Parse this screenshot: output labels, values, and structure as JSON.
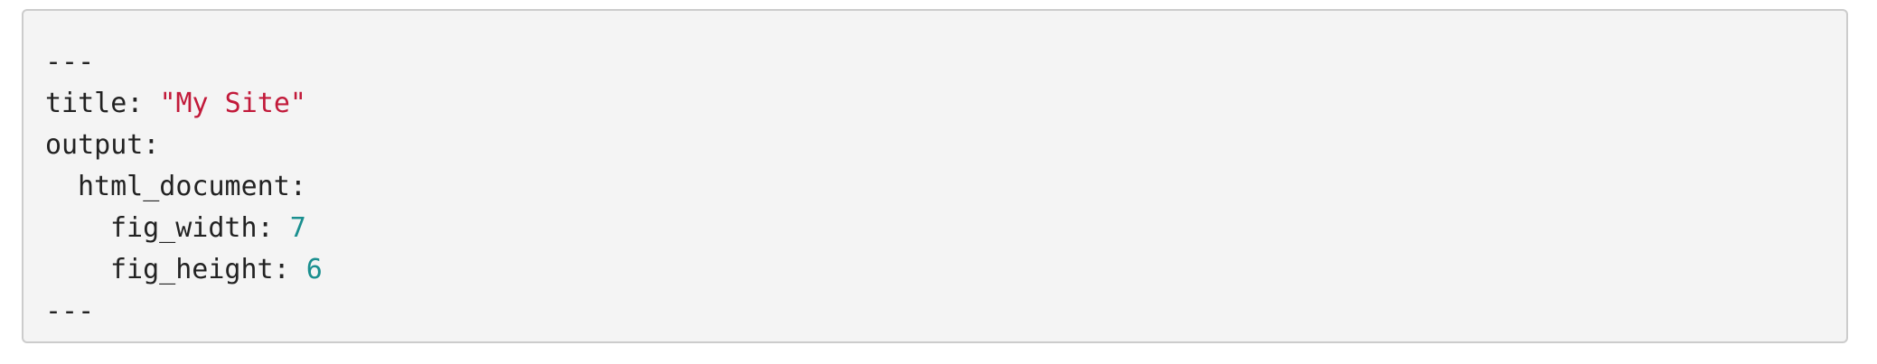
{
  "code_block": {
    "language": "yaml",
    "colors": {
      "background": "#f4f4f4",
      "border": "#cccccc",
      "text": "#222222",
      "string": "#c21a3a",
      "number": "#1a8f8f"
    },
    "lines": [
      {
        "text": "---"
      },
      {
        "key": "title",
        "sep": ": ",
        "value": "\"My Site\""
      },
      {
        "key": "output",
        "sep": ":"
      },
      {
        "key": "html_document",
        "sep": ":"
      },
      {
        "key": "fig_width",
        "sep": ": ",
        "value": "7"
      },
      {
        "key": "fig_height",
        "sep": ": ",
        "value": "6"
      },
      {
        "text": "---"
      }
    ]
  }
}
